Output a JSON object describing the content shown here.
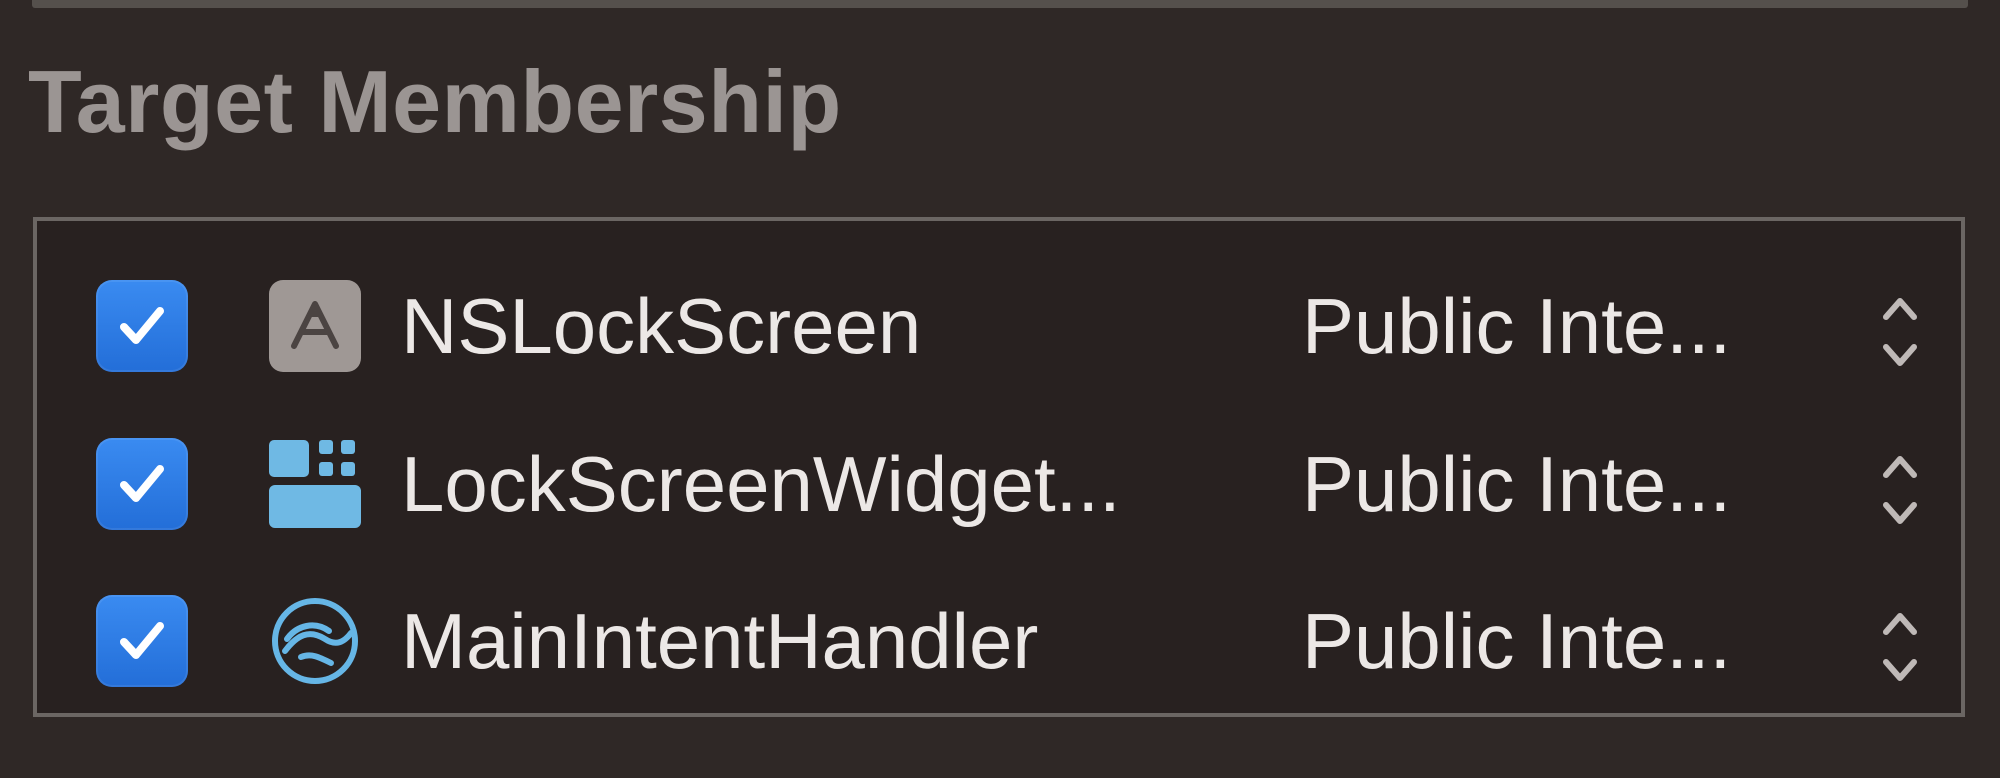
{
  "section": {
    "title": "Target Membership"
  },
  "targets": [
    {
      "name": "NSLockScreen",
      "checked": true,
      "icon": "app-store-icon",
      "access": "Public Inte..."
    },
    {
      "name": "LockScreenWidget...",
      "checked": true,
      "icon": "widget-extension-icon",
      "access": "Public Inte..."
    },
    {
      "name": "MainIntentHandler",
      "checked": true,
      "icon": "intents-extension-icon",
      "access": "Public Inte..."
    }
  ],
  "colors": {
    "background": "#2f2826",
    "box": "#282120",
    "checkbox": "#2f7de6",
    "title": "#9b9593",
    "text": "#ece8e6"
  }
}
